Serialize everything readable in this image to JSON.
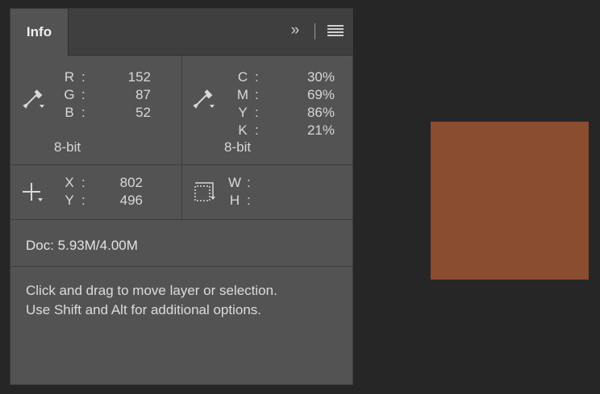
{
  "panel": {
    "tab_label": "Info"
  },
  "rgb": {
    "labels": [
      "R",
      "G",
      "B"
    ],
    "values": [
      "152",
      "87",
      "52"
    ],
    "bit_depth": "8-bit"
  },
  "cmyk": {
    "labels": [
      "C",
      "M",
      "Y",
      "K"
    ],
    "values": [
      "30%",
      "69%",
      "86%",
      "21%"
    ],
    "bit_depth": "8-bit"
  },
  "position": {
    "labels": [
      "X",
      "Y"
    ],
    "values": [
      "802",
      "496"
    ]
  },
  "size": {
    "labels": [
      "W",
      "H"
    ],
    "values": [
      "",
      ""
    ]
  },
  "colon": ":",
  "doc": {
    "text": "Doc: 5.93M/4.00M"
  },
  "hint": {
    "line1": "Click and drag to move layer or selection.",
    "line2": "Use Shift and Alt for additional options."
  },
  "icons": {
    "eyedropper": "eyedropper-icon",
    "crosshair": "crosshair-icon",
    "selection": "selection-size-icon",
    "expand": "double-chevron-icon",
    "menu": "panel-menu-icon"
  },
  "colors": {
    "swatch": "#8B4D30",
    "panel_bg": "#535353",
    "canvas_bg": "#262626"
  }
}
